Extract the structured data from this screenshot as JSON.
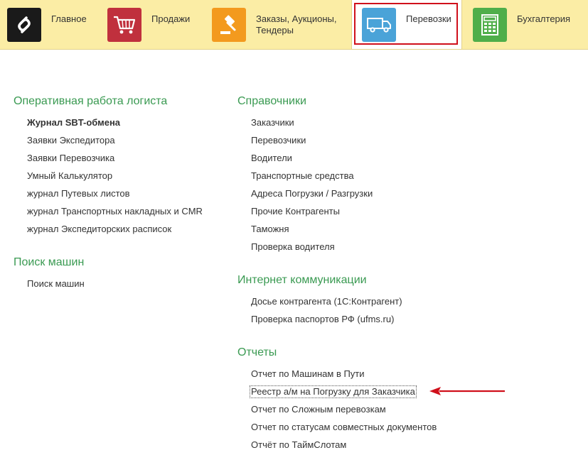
{
  "sections": [
    {
      "label": "Главное",
      "icon": "1c-logo-icon",
      "color": "#1a1a1a"
    },
    {
      "label": "Продажи",
      "icon": "shopping-cart-icon",
      "color": "#c0303d"
    },
    {
      "label": "Заказы,  Аукционы, Тендеры",
      "icon": "gavel-icon",
      "color": "#f39a1e"
    },
    {
      "label": "Перевозки",
      "icon": "truck-icon",
      "color": "#4aa3d8"
    },
    {
      "label": "Бухгалтерия",
      "icon": "calculator-icon",
      "color": "#4fae4a"
    }
  ],
  "active_section": "Перевозки",
  "groups": {
    "operative": {
      "title": "Оперативная работа логиста",
      "items": [
        "Журнал SBT-обмена",
        "Заявки Экспедитора",
        "Заявки Перевозчика",
        "Умный Калькулятор",
        "журнал Путевых листов",
        "журнал Транспортных накладных и CMR",
        "журнал Экспедиторских расписок"
      ]
    },
    "search": {
      "title": "Поиск машин",
      "items": [
        "Поиск машин"
      ]
    },
    "refs": {
      "title": "Справочники",
      "items": [
        "Заказчики",
        "Перевозчики",
        "Водители",
        "Транспортные средства",
        "Адреса Погрузки / Разгрузки",
        "Прочие Контрагенты",
        "Таможня",
        "Проверка водителя"
      ]
    },
    "internet": {
      "title": "Интернет коммуникации",
      "items": [
        "Досье контрагента (1С:Контрагент)",
        "Проверка паспортов РФ (ufms.ru)"
      ]
    },
    "reports": {
      "title": "Отчеты",
      "items": [
        "Отчет по Машинам в Пути",
        "Реестр а/м на Погрузку для Заказчика",
        "Отчет по Сложным перевозкам",
        "Отчет по статусам совместных документов",
        "Отчёт по ТаймСлотам"
      ]
    }
  },
  "colors": {
    "accent_green": "#3a9a52",
    "highlight_red": "#d0101b",
    "topbar_bg": "#fbeda5"
  }
}
